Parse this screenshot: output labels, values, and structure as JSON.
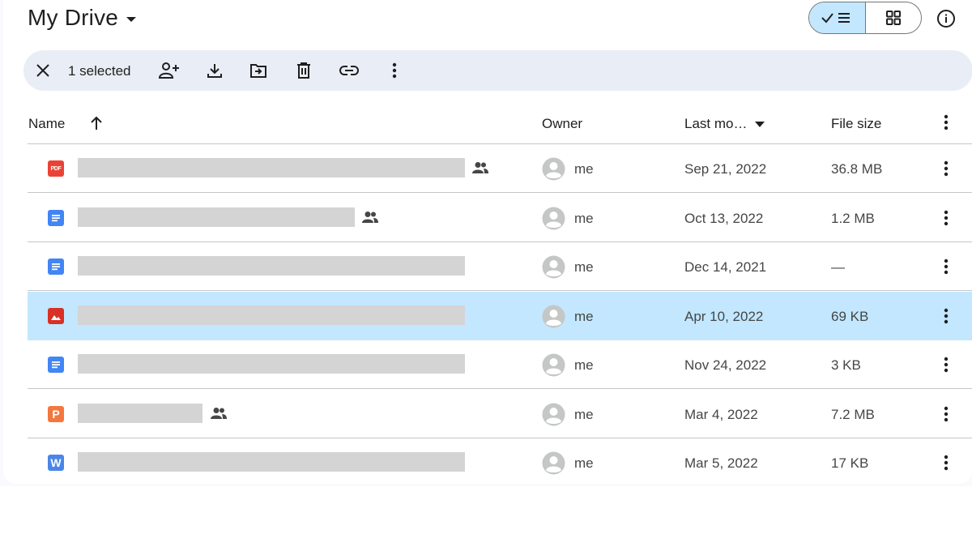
{
  "header": {
    "title": "My Drive",
    "title_icon": "caret-down-icon",
    "view_list_icons": "check-icon, list-icon",
    "view_grid_icon": "grid-icon",
    "info_icon": "info-icon"
  },
  "toolbar": {
    "selection_count": "1 selected",
    "icons": [
      "close-icon",
      "share-person-add-icon",
      "download-icon",
      "move-to-folder-icon",
      "trash-icon",
      "link-icon",
      "more-vert-icon"
    ]
  },
  "table": {
    "columns": {
      "name": "Name",
      "owner": "Owner",
      "last_modified": "Last mo…",
      "file_size": "File size"
    },
    "sort_icon": "arrow-up-icon",
    "rows": [
      {
        "type": "pdf",
        "type_label": "PDF",
        "shared": true,
        "owner": "me",
        "date": "Sep 21, 2022",
        "size": "36.8 MB",
        "selected": false
      },
      {
        "type": "doc",
        "type_label": "",
        "shared": true,
        "owner": "me",
        "date": "Oct 13, 2022",
        "size": "1.2 MB",
        "selected": false
      },
      {
        "type": "doc",
        "type_label": "",
        "shared": false,
        "owner": "me",
        "date": "Dec 14, 2021",
        "size": "—",
        "selected": false
      },
      {
        "type": "image",
        "type_label": "",
        "shared": false,
        "owner": "me",
        "date": "Apr 10, 2022",
        "size": "69 KB",
        "selected": true
      },
      {
        "type": "doc",
        "type_label": "",
        "shared": false,
        "owner": "me",
        "date": "Nov 24, 2022",
        "size": "3 KB",
        "selected": false
      },
      {
        "type": "slides",
        "type_label": "P",
        "shared": true,
        "owner": "me",
        "date": "Mar 4, 2022",
        "size": "7.2 MB",
        "selected": false
      },
      {
        "type": "word",
        "type_label": "W",
        "shared": false,
        "owner": "me",
        "date": "Mar 5, 2022",
        "size": "17 KB",
        "selected": false
      }
    ]
  },
  "colors": {
    "accent_selected": "#c2e7ff",
    "toolbar_bg": "#e9eef6",
    "pdf": "#ea4335",
    "doc": "#4285f4",
    "image": "#d93025",
    "slides": "#f4773f",
    "word": "#4a86e8"
  }
}
